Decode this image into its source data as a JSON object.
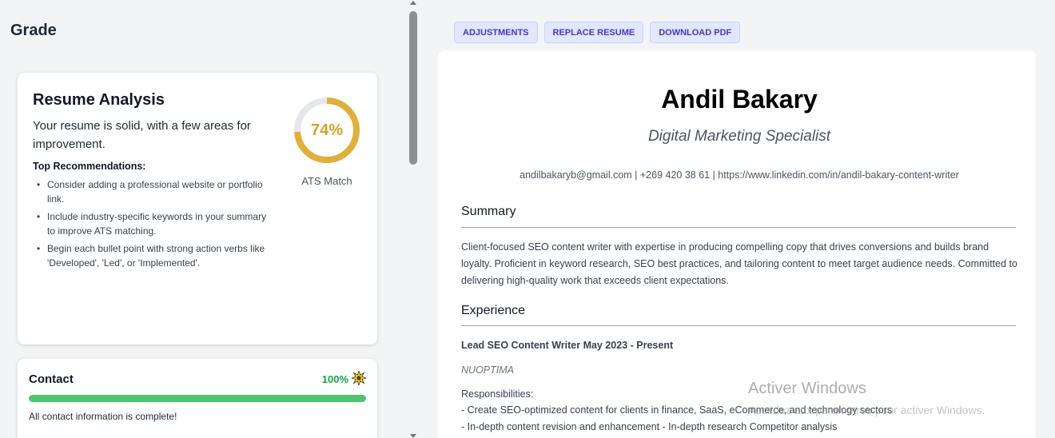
{
  "left": {
    "grade_title": "Grade",
    "analysis": {
      "title": "Resume Analysis",
      "summary": "Your resume is solid, with a few areas for improvement.",
      "recommendations_title": "Top Recommendations:",
      "recommendations": [
        "Consider adding a professional website or portfolio link.",
        "Include industry-specific keywords in your summary to improve ATS matching.",
        "Begin each bullet point with strong action verbs like 'Developed', 'Led', or 'Implemented'."
      ],
      "ats_score_text": "74%",
      "ats_score_value": 74,
      "ats_label": "ATS Match",
      "gauge_color": "#e0b03a",
      "gauge_track_color": "#e5e7eb"
    },
    "contact": {
      "title": "Contact",
      "percent_text": "100%",
      "percent_value": 100,
      "badge_icon": "starburst-icon",
      "note": "All contact information is complete!",
      "bar_color": "#4ec46c"
    }
  },
  "toolbar": {
    "adjustments_label": "ADJUSTMENTS",
    "replace_label": "REPLACE RESUME",
    "download_label": "DOWNLOAD PDF"
  },
  "resume": {
    "name": "Andil Bakary",
    "role": "Digital Marketing Specialist",
    "contact_line": "andilbakaryb@gmail.com | +269 420 38 61 | https://www.linkedin.com/in/andil-bakary-content-writer",
    "summary_heading": "Summary",
    "summary_text": "Client-focused SEO content writer with expertise in producing compelling copy that drives conversions and builds brand loyalty. Proficient in keyword research, SEO best practices, and tailoring content to meet target audience needs. Committed to delivering high-quality work that exceeds client expectations.",
    "experience_heading": "Experience",
    "job_title": "Lead SEO Content Writer May 2023 - Present",
    "company": "NUOPTIMA",
    "responsibilities_label": "Responsibilities:",
    "responsibilities": [
      "- Create SEO-optimized content for clients in finance, SaaS, eCommerce, and technology sectors",
      "- In-depth content revision and enhancement - In-depth research Competitor analysis"
    ]
  },
  "watermark": {
    "line1": "Activer Windows",
    "line2": "Accédez aux paramètres pour activer Windows."
  }
}
